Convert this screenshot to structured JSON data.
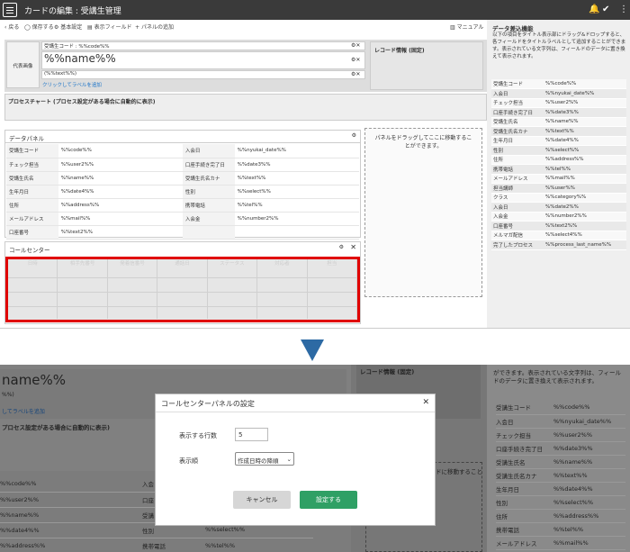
{
  "app": {
    "title": "カードの編集 : 受講生管理"
  },
  "toolbar": {
    "back": "戻る",
    "save": "保存する",
    "basic": "基本設定",
    "fields": "表示フィールド",
    "add_panel": "パネルの追加",
    "manual": "マニュアル"
  },
  "card": {
    "photo": "代表画像",
    "code_label": "受講生コード : %%code%%",
    "name_value": "%%name%%",
    "text_value": "(%%text%%)",
    "label_link": "クリックしてラベルを追加"
  },
  "record_info": "レコード情報 (固定)",
  "process": "プロセスチャート (プロセス設定がある場合に自動的に表示)",
  "data_panel": {
    "title": "データパネル",
    "rows": [
      [
        "受講生コード",
        "%%code%%",
        "入会日",
        "%%nyukai_date%%"
      ],
      [
        "チェック担当",
        "%%user2%%",
        "口座手続き完了日",
        "%%date3%%"
      ],
      [
        "受講生氏名",
        "%%name%%",
        "受講生氏名カナ",
        "%%text%%"
      ],
      [
        "生年月日",
        "%%date4%%",
        "性別",
        "%%select%%"
      ],
      [
        "住所",
        "%%address%%",
        "携帯電話",
        "%%tel%%"
      ],
      [
        "メールアドレス",
        "%%mail%%",
        "入会金",
        "%%number2%%"
      ],
      [
        "口座番号",
        "%%text2%%",
        "",
        ""
      ]
    ]
  },
  "drop_hint": "パネルをドラッグしてここに移動することができます。",
  "call_center": {
    "title": "コールセンター",
    "columns": [
      "日時",
      "相手先番号",
      "発着信番号",
      "通話日",
      "ステータス",
      "対応者",
      "担当"
    ]
  },
  "side": {
    "title": "データ差込機能",
    "desc": "以下の項目をタイトル表示部にドラッグ&ドロップすると、各フィールドをタイトルラベルとして追加することができます。表示されている文字列は、フィールドのデータに置き換えて表示されます。",
    "fields": [
      [
        "受講生コード",
        "%%code%%"
      ],
      [
        "入会日",
        "%%nyukai_date%%"
      ],
      [
        "チェック担当",
        "%%user2%%"
      ],
      [
        "口座手続き完了日",
        "%%date3%%"
      ],
      [
        "受講生氏名",
        "%%name%%"
      ],
      [
        "受講生氏名カナ",
        "%%text%%"
      ],
      [
        "生年月日",
        "%%date4%%"
      ],
      [
        "性別",
        "%%select%%"
      ],
      [
        "住所",
        "%%address%%"
      ],
      [
        "携帯電話",
        "%%tel%%"
      ],
      [
        "メールアドレス",
        "%%mail%%"
      ],
      [
        "担当講師",
        "%%user%%"
      ],
      [
        "クラス",
        "%%category%%"
      ],
      [
        "入会日",
        "%%date2%%"
      ],
      [
        "入会金",
        "%%number2%%"
      ],
      [
        "口座番号",
        "%%text2%%"
      ],
      [
        "メルマガ配信",
        "%%select4%%"
      ],
      [
        "完了したプロセス",
        "%%process_last_name%%"
      ]
    ]
  },
  "bg": {
    "name": "name%%",
    "text": "%%)",
    "label": "してラベルを追加",
    "process": "プロセス設定がある場合に自動的に表示)",
    "record": "レコード情報 (固定)",
    "side_desc": "ができます。表示されている文字列は、フィールドのデータに置き換えて表示されます。",
    "rows": [
      [
        "%%code%%",
        "入会"
      ],
      [
        "%%user2%%",
        "口座"
      ],
      [
        "%%name%%",
        "受講"
      ],
      [
        "%%date4%%",
        "性別"
      ],
      [
        "%%address%%",
        "携帯電話"
      ]
    ],
    "row_right": [
      "%%select%%",
      "%%tel%%"
    ],
    "side_fields": [
      [
        "受講生コード",
        "%%code%%"
      ],
      [
        "入会日",
        "%%nyukai_date%%"
      ],
      [
        "チェック担当",
        "%%user2%%"
      ],
      [
        "口座手続き完了日",
        "%%date3%%"
      ],
      [
        "受講生氏名",
        "%%name%%"
      ],
      [
        "受講生氏名カナ",
        "%%text%%"
      ],
      [
        "生年月日",
        "%%date4%%"
      ],
      [
        "性別",
        "%%select%%"
      ],
      [
        "住所",
        "%%address%%"
      ],
      [
        "携帯電話",
        "%%tel%%"
      ],
      [
        "メールアドレス",
        "%%mail%%"
      ]
    ],
    "drop": "ドに移動すること"
  },
  "dialog": {
    "title": "コールセンターパネルの設定",
    "rows_label": "表示する行数",
    "rows_value": "5",
    "order_label": "表示順",
    "order_value": "作成日時の降順",
    "cancel": "キャンセル",
    "ok": "設定する"
  }
}
